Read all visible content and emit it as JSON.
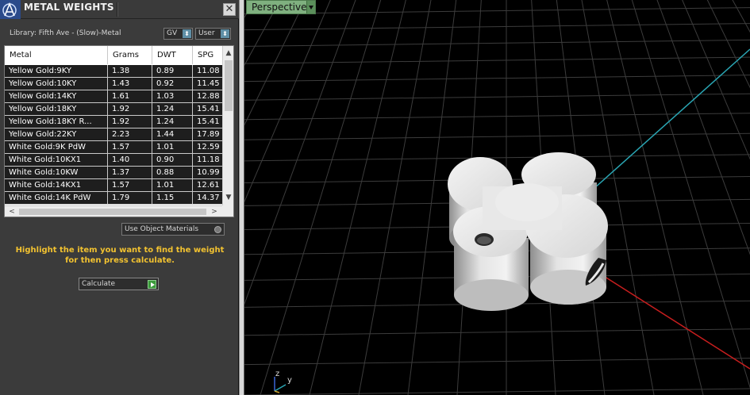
{
  "panel": {
    "title": "METAL WEIGHTS",
    "close_glyph": "✕",
    "library_label": "Library: Fifth Ave - (Slow)-Metal",
    "unit_dropdown": "GV",
    "source_dropdown": "User",
    "dropdown_arrow": "⬍"
  },
  "table": {
    "columns": [
      "Metal",
      "Grams",
      "DWT",
      "SPG"
    ],
    "rows": [
      [
        "Yellow Gold:9KY",
        "1.38",
        "0.89",
        "11.08"
      ],
      [
        "Yellow Gold:10KY",
        "1.43",
        "0.92",
        "11.45"
      ],
      [
        "Yellow Gold:14KY",
        "1.61",
        "1.03",
        "12.88"
      ],
      [
        "Yellow Gold:18KY",
        "1.92",
        "1.24",
        "15.41"
      ],
      [
        "Yellow Gold:18KY R...",
        "1.92",
        "1.24",
        "15.41"
      ],
      [
        "Yellow Gold:22KY",
        "2.23",
        "1.44",
        "17.89"
      ],
      [
        "White Gold:9K PdW",
        "1.57",
        "1.01",
        "12.59"
      ],
      [
        "White Gold:10KX1",
        "1.40",
        "0.90",
        "11.18"
      ],
      [
        "White Gold:10KW",
        "1.37",
        "0.88",
        "10.99"
      ],
      [
        "White Gold:14KX1",
        "1.57",
        "1.01",
        "12.61"
      ],
      [
        "White Gold:14K PdW",
        "1.79",
        "1.15",
        "14.37"
      ]
    ],
    "scroll_up": "▲",
    "scroll_down": "▼",
    "scroll_left": "<",
    "scroll_right": ">"
  },
  "use_object_materials": "Use Object Materials",
  "hint": "Highlight the item you want to find the weight for then press calculate.",
  "calculate_label": "Calculate",
  "viewport": {
    "mode_label": "Perspective",
    "axis_z": "z",
    "axis_y": "y"
  },
  "colors": {
    "hint": "#f2c230",
    "viewport_tab": "#7fb07f",
    "axis_x": "#c81e1e",
    "axis_y": "#2aa6b4",
    "calculate_go": "#3a9a3a"
  }
}
